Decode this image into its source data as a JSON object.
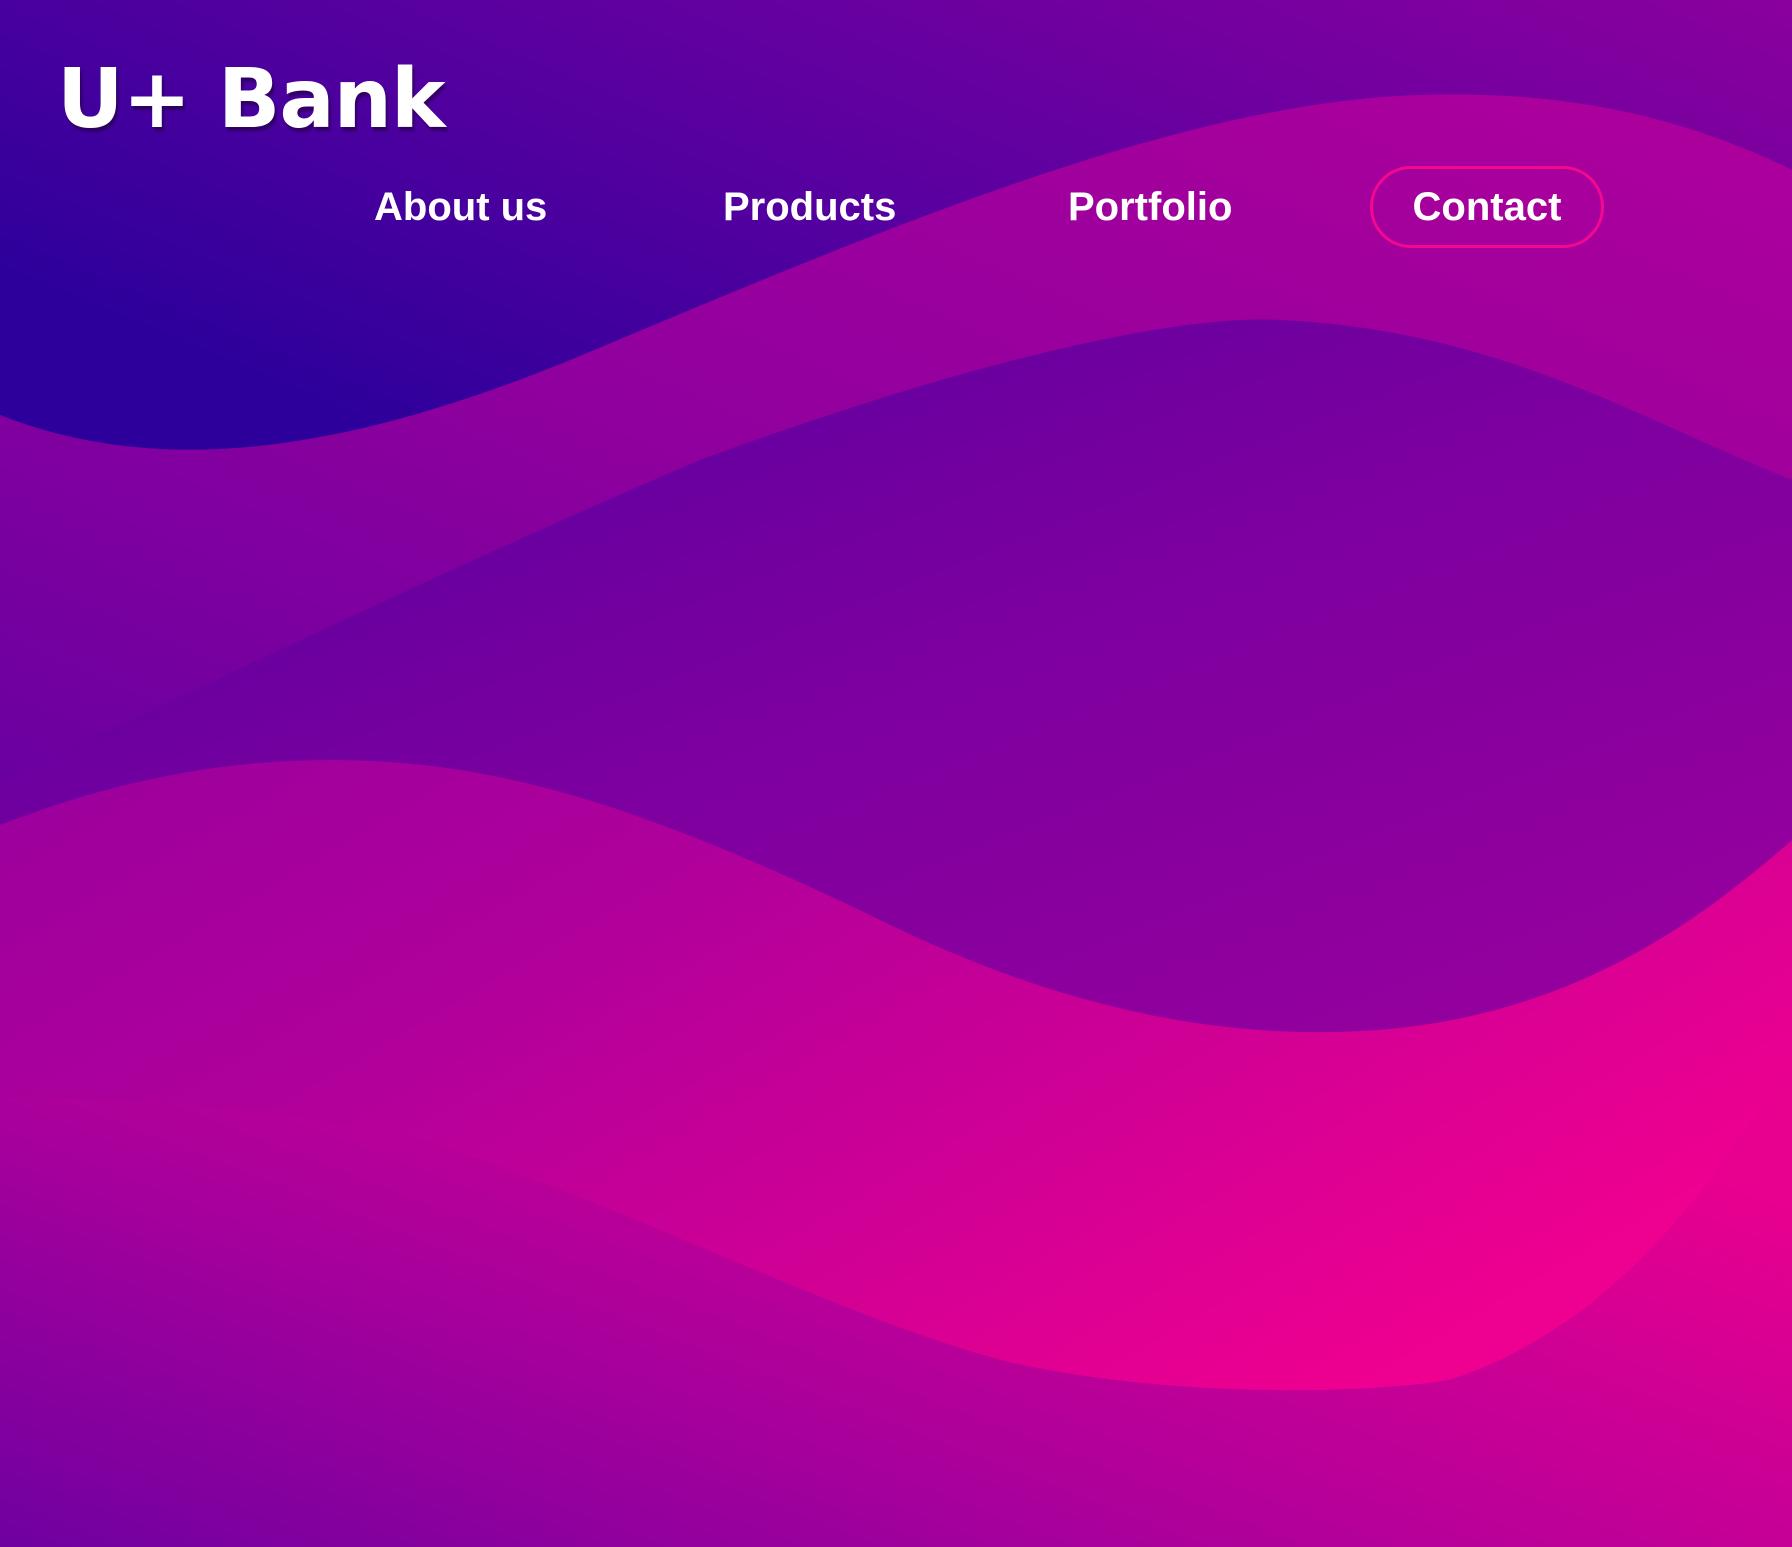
{
  "brand": {
    "name": "U+ Bank"
  },
  "nav": {
    "items": [
      {
        "label": "About us"
      },
      {
        "label": "Products"
      },
      {
        "label": "Portfolio"
      },
      {
        "label": "Contact"
      }
    ]
  },
  "theme": {
    "deep_indigo": "#2e009b",
    "violet": "#7a009f",
    "magenta": "#b0009a",
    "hot_pink": "#f4008f",
    "contact_border": "#f4088f",
    "text": "#ffffff"
  }
}
